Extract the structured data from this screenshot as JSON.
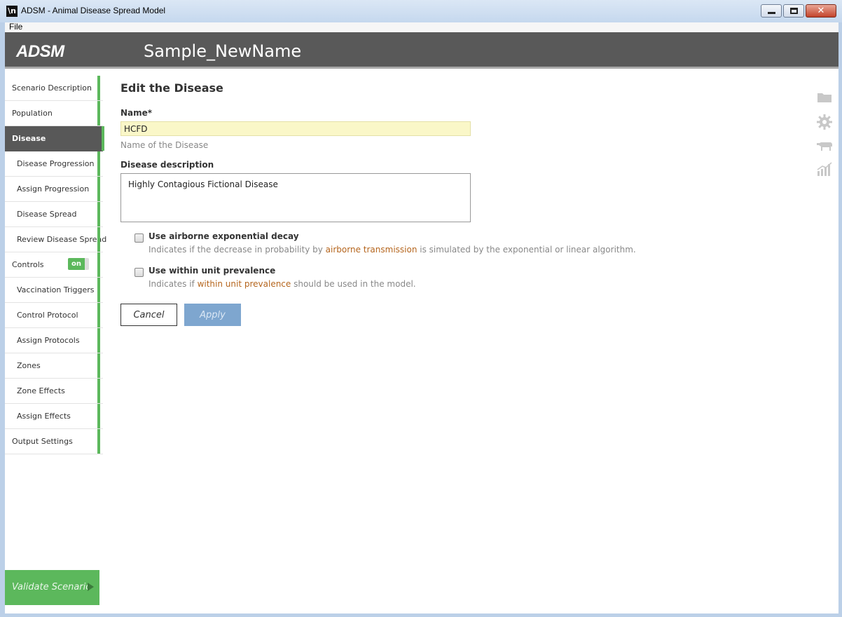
{
  "window": {
    "title": "ADSM - Animal Disease Spread Model",
    "icon_glyph": "\\n",
    "controls": [
      "minimize",
      "maximize",
      "close"
    ]
  },
  "menu": {
    "file": "File"
  },
  "header": {
    "logo": "ADSM",
    "scenario_name": "Sample_NewName"
  },
  "sidebar": {
    "items": [
      {
        "label": "Scenario Description",
        "level": 0
      },
      {
        "label": "Population",
        "level": 0
      },
      {
        "label": "Disease",
        "level": 0,
        "active": true
      },
      {
        "label": "Disease Progression",
        "level": 1
      },
      {
        "label": "Assign Progression",
        "level": 1
      },
      {
        "label": "Disease Spread",
        "level": 1
      },
      {
        "label": "Review Disease Spread",
        "level": 1
      },
      {
        "label": "Controls",
        "level": 0,
        "toggle": "on"
      },
      {
        "label": "Vaccination Triggers",
        "level": 1
      },
      {
        "label": "Control Protocol",
        "level": 1
      },
      {
        "label": "Assign Protocols",
        "level": 1
      },
      {
        "label": "Zones",
        "level": 1
      },
      {
        "label": "Zone Effects",
        "level": 1
      },
      {
        "label": "Assign Effects",
        "level": 1
      },
      {
        "label": "Output Settings",
        "level": 0
      }
    ],
    "validate_label": "Validate Scenario"
  },
  "form": {
    "title": "Edit the Disease",
    "name_label": "Name*",
    "name_value": "HCFD",
    "name_help": "Name of the Disease",
    "description_label": "Disease description",
    "description_value": "Highly Contagious Fictional Disease",
    "airborne": {
      "label": "Use airborne exponential decay",
      "checked": false,
      "help_before": "Indicates if the decrease in probability by ",
      "help_link": "airborne transmission",
      "help_after": " is simulated by the exponential or linear algorithm."
    },
    "prevalence": {
      "label": "Use within unit prevalence",
      "checked": false,
      "help_before": "Indicates if ",
      "help_link": "within unit prevalence",
      "help_after": " should be used in the model."
    },
    "cancel_label": "Cancel",
    "apply_label": "Apply"
  },
  "right_toolbar": {
    "icons": [
      "folder-icon",
      "gear-icon",
      "cow-icon",
      "chart-icon"
    ]
  },
  "colors": {
    "accent_green": "#5cb85c",
    "header_bg": "#595959",
    "link": "#b5651d",
    "apply_bg": "#7ea6cf",
    "name_input_bg": "#faf7c8"
  }
}
